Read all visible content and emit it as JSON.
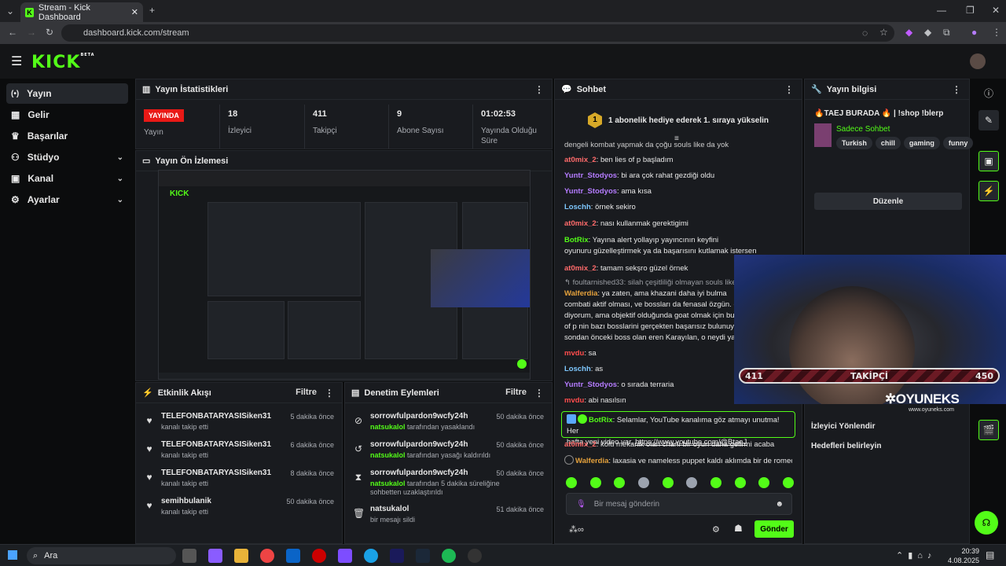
{
  "browser": {
    "tab_title": "Stream - Kick Dashboard",
    "url": "dashboard.kick.com/stream"
  },
  "header": {
    "logo": "KICK",
    "logo_tag": "BETA"
  },
  "sidebar": {
    "items": [
      {
        "label": "Yayın",
        "icon": "broadcast-icon"
      },
      {
        "label": "Gelir",
        "icon": "revenue-icon"
      },
      {
        "label": "Başarılar",
        "icon": "trophy-icon"
      },
      {
        "label": "Stüdyo",
        "icon": "studio-icon"
      },
      {
        "label": "Kanal",
        "icon": "channel-icon"
      },
      {
        "label": "Ayarlar",
        "icon": "gear-icon"
      }
    ]
  },
  "stats": {
    "title": "Yayın İstatistikleri",
    "status_badge": "YAYINDA",
    "status_label": "Yayın",
    "viewers": "18",
    "viewers_label": "İzleyici",
    "followers": "411",
    "followers_label": "Takipçi",
    "subs": "9",
    "subs_label": "Abone Sayısı",
    "uptime": "01:02:53",
    "uptime_label": "Yayında Olduğu Süre"
  },
  "preview": {
    "title": "Yayın Ön İzlemesi"
  },
  "activity": {
    "title": "Etkinlik Akışı",
    "filter": "Filtre",
    "items": [
      {
        "name": "TELEFONBATARYASISiken31",
        "sub": "kanalı takip etti",
        "time": "5 dakika önce"
      },
      {
        "name": "TELEFONBATARYASISiken31",
        "sub": "kanalı takip etti",
        "time": "6 dakika önce"
      },
      {
        "name": "TELEFONBATARYASISiken31",
        "sub": "kanalı takip etti",
        "time": "8 dakika önce"
      },
      {
        "name": "semihbulanik",
        "sub": "kanalı takip etti",
        "time": "50 dakika önce"
      }
    ]
  },
  "moderation": {
    "title": "Denetim Eylemleri",
    "filter": "Filtre",
    "items": [
      {
        "name": "sorrowfulpardon9wcfy24h",
        "actor": "natsukalol",
        "sub": "tarafından yasaklandı",
        "time": "50 dakika önce"
      },
      {
        "name": "sorrowfulpardon9wcfy24h",
        "actor": "natsukalol",
        "sub": "tarafından yasağı kaldırıldı",
        "time": "50 dakika önce"
      },
      {
        "name": "sorrowfulpardon9wcfy24h",
        "actor": "natsukalol",
        "sub": "tarafından 5 dakika süreliğine sohbetten uzaklaştırıldı",
        "time": "50 dakika önce"
      },
      {
        "name": "natsukalol",
        "actor": "",
        "sub": "bir mesajı sildi",
        "time": "51 dakika önce"
      }
    ]
  },
  "chat": {
    "title": "Sohbet",
    "pinned": "1 abonelik hediye ederek 1. sıraya yükselin",
    "top_line": "dengeli kombat yapmak da çoğu souls like da yok",
    "messages": [
      {
        "user": "at0mix_2",
        "color": "#ff6b6b",
        "text": "ben lies of p başladım"
      },
      {
        "user": "Yuntr_Stodyos",
        "color": "#b57cff",
        "text": "bi ara çok rahat gezdiği oldu"
      },
      {
        "user": "Yuntr_Stodyos",
        "color": "#b57cff",
        "text": "ama kısa"
      },
      {
        "user": "Loschh",
        "color": "#7ec8ff",
        "text": "örnek sekiro"
      },
      {
        "user": "at0mix_2",
        "color": "#ff6b6b",
        "text": "nası kullanmak gerektigimi"
      },
      {
        "user": "BotRix",
        "color": "#53fc18",
        "text": "Yayına alert yollayıp yayıncının keyfini"
      },
      {
        "user": "",
        "color": "#e8e8e8",
        "text": "oyunuru güzelleştirmek ya da başarısını kutlamak istersen"
      },
      {
        "user": "at0mix_2",
        "color": "#ff6b6b",
        "text": "tamam sekşro güzel örnek"
      },
      {
        "user": "",
        "color": "#9a9da3",
        "text": "↰ foultarnished33: silah çeşitliliği olmayan souls like'lar"
      },
      {
        "user": "Walferdia",
        "color": "#e6a23c",
        "text": "ya zaten, ama khazani daha iyi bulma"
      },
      {
        "user": "",
        "color": "#e8e8e8",
        "text": "combati aktif olması, ve bossları da fenasal özgün. o"
      },
      {
        "user": "",
        "color": "#e8e8e8",
        "text": "diyorum, ama objektif olduğunda goat olmak için bun"
      },
      {
        "user": "",
        "color": "#e8e8e8",
        "text": "of p nin bazı bosslarini gerçekten başarısız bulunuyo"
      },
      {
        "user": "",
        "color": "#e8e8e8",
        "text": "sondan önceki boss olan eren Karayılan, o neydi ya"
      },
      {
        "user": "mvdu",
        "color": "#ff4d4d",
        "text": "sa"
      },
      {
        "user": "Loschh",
        "color": "#7ec8ff",
        "text": "as"
      },
      {
        "user": "Yuntr_Stodyos",
        "color": "#b57cff",
        "text": "o sırada terraria"
      },
      {
        "user": "mvdu",
        "color": "#ff4d4d",
        "text": "abi nasılsın"
      }
    ],
    "highlight_user": "BotRix",
    "highlight_text": "Selamlar, YouTube kanalıma göz atmayı unutma! Her",
    "highlight_text2": "hafta yeni video var.",
    "highlight_link": "https://www.youtube.com/@BtaeJ",
    "after": [
      {
        "user": "at0mix_2",
        "color": "#ff6b6b",
        "text": "kolu mekanik olan charlı bir oyun daha gelirmi acaba"
      },
      {
        "user": "Walferdia",
        "color": "#e6a23c",
        "text": "laxasia ve nameless puppet kaldı aklımda bir de romeo"
      }
    ],
    "input_placeholder": "Bir mesaj gönderin",
    "send": "Gönder"
  },
  "info": {
    "title": "Yayın bilgisi",
    "stream_title": "🔥TAEJ BURADA 🔥 | !shop !blerp",
    "category": "Sadece Sohbet",
    "tags": [
      "Turkish",
      "chill",
      "gaming",
      "funny"
    ],
    "edit": "Düzenle",
    "links": [
      "İzleyici Yönlendir",
      "Hedefleri belirleyin"
    ]
  },
  "overlay": {
    "left": "411",
    "mid": "TAKİPÇİ",
    "right": "450",
    "brand": "OYUNEKS",
    "brand_url": "www.oyuneks.com"
  },
  "taskbar": {
    "search": "Ara",
    "time": "20:39",
    "date": "4.08.2025"
  }
}
